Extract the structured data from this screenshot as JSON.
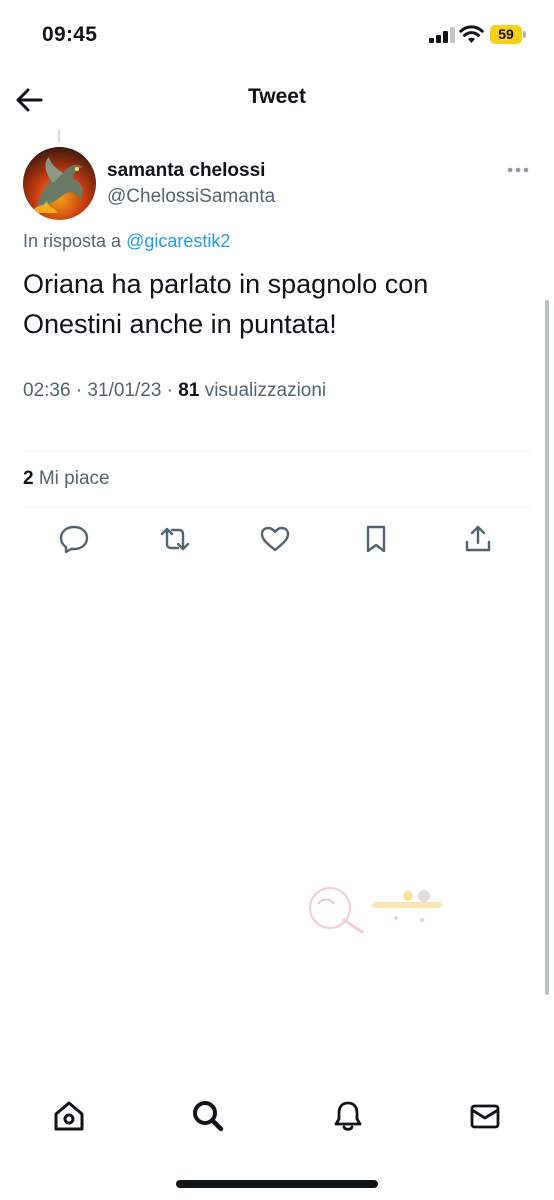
{
  "status_bar": {
    "time": "09:45",
    "battery_level": "59",
    "battery_color": "#f7d117"
  },
  "nav": {
    "back_icon": "arrow-left-icon",
    "title": "Tweet"
  },
  "tweet": {
    "author": {
      "display_name": "samanta chelossi",
      "handle": "@ChelossiSamanta",
      "avatar_icon": "dragon-avatar"
    },
    "reply_context": {
      "prefix": "In risposta a",
      "mention": "@gicarestik2"
    },
    "text": "Oriana ha parlato in spagnolo con Onestini anche in puntata!",
    "timestamp": "02:36 · 31/01/23 ·",
    "views_count": "81",
    "views_label": "visualizzazioni",
    "likes_count": "2",
    "likes_label": "Mi piace"
  },
  "actions": [
    {
      "name": "reply",
      "icon": "comment-icon"
    },
    {
      "name": "retweet",
      "icon": "retweet-icon"
    },
    {
      "name": "like",
      "icon": "heart-icon"
    },
    {
      "name": "bookmark",
      "icon": "bookmark-icon"
    },
    {
      "name": "share",
      "icon": "share-icon"
    }
  ],
  "bottom_nav": [
    {
      "name": "home",
      "icon": "home-icon"
    },
    {
      "name": "search",
      "icon": "search-icon"
    },
    {
      "name": "notifications",
      "icon": "bell-icon"
    },
    {
      "name": "messages",
      "icon": "mail-icon"
    }
  ],
  "colors": {
    "text_primary": "#0f1419",
    "text_secondary": "#536471",
    "link": "#1d9bf0",
    "divider": "#eff3f4"
  }
}
